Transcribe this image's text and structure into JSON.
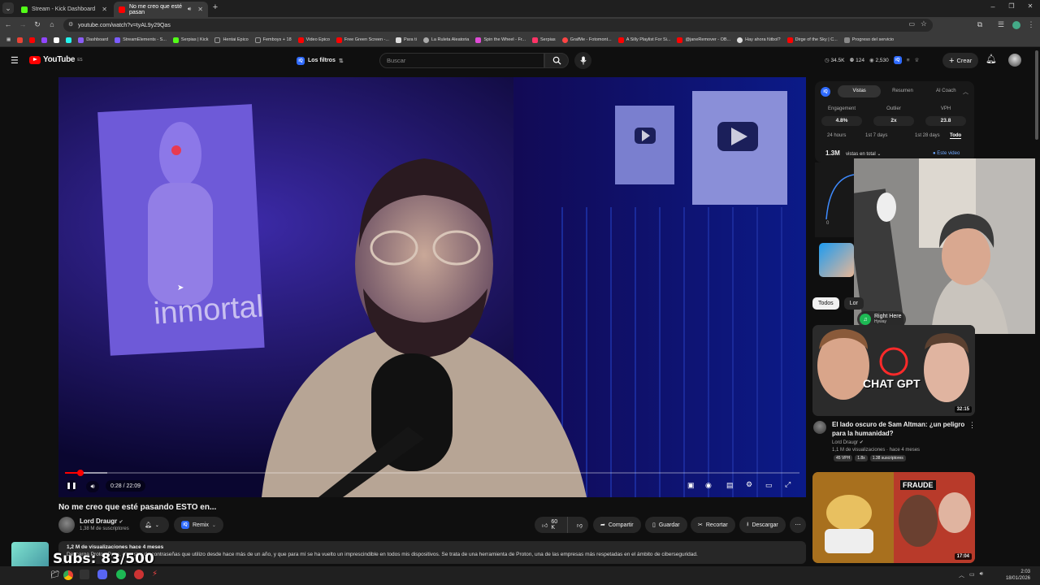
{
  "browser": {
    "tabs": [
      {
        "title": "Stream - Kick Dashboard",
        "favicon_color": "#53fc18"
      },
      {
        "title": "No me creo que esté pasan",
        "favicon_color": "#ff0000"
      }
    ],
    "url": "youtube.com/watch?v=tyAL9y29Qas",
    "bookmarks": [
      {
        "label": "Dashboard",
        "color": "#8a5cf6"
      },
      {
        "label": "StreamElements - S...",
        "color": "#7b5cff"
      },
      {
        "label": "Serpias | Kick",
        "color": "#53fc18"
      },
      {
        "label": "Hentai Epico",
        "color": "#777777"
      },
      {
        "label": "Femboys + 18",
        "color": "#777777"
      },
      {
        "label": "Video Epico",
        "color": "#ff0000"
      },
      {
        "label": "Free Green Screen -...",
        "color": "#ff0000"
      },
      {
        "label": "Para ti",
        "color": "#dddddd"
      },
      {
        "label": "La Ruleta Aleatoria",
        "color": "#aaaaaa"
      },
      {
        "label": "Spin the Wheel - Fr...",
        "color": "#e04bd6"
      },
      {
        "label": "Serpias",
        "color": "#ff3366"
      },
      {
        "label": "GrafMe - Fotomont...",
        "color": "#ff4444"
      },
      {
        "label": "A Silly Playlist For Si...",
        "color": "#ff0000"
      },
      {
        "label": "@janeRemover - OB...",
        "color": "#ff0000"
      },
      {
        "label": "Hay ahora fútbol?",
        "color": "#dddddd"
      },
      {
        "label": "Dirge of the Sky | C...",
        "color": "#ff0000"
      },
      {
        "label": "Progreso del servicio",
        "color": "#888888"
      }
    ]
  },
  "youtube": {
    "logo_text": "YouTube",
    "country_code": "ES",
    "filters_label": "Los filtros",
    "search_placeholder": "Buscar",
    "header_stats": [
      "34.5K",
      "124",
      "2,530"
    ],
    "create_label": "Crear"
  },
  "video": {
    "overlay_text": "inmortal",
    "current_time": "0:28",
    "duration": "22:09",
    "time_display": "0:28 / 22:09",
    "progress_fraction": 0.021,
    "buffer_fraction": 0.058,
    "title": "No me creo que esté pasando ESTO en...",
    "channel": "Lord Draugr",
    "subscribers": "1,38 M de suscriptores",
    "remix_label": "Remix",
    "likes": "60 K",
    "share_label": "Compartir",
    "save_label": "Guardar",
    "clip_label": "Recortar",
    "download_label": "Descargar",
    "desc_meta": "1,2 M de visualizaciones  hace 4 meses",
    "desc_text": "Descarga Proton Pass, el gestor de contraseñas que utilizo desde hace más de un año, y que para mí se ha vuelto un imprescindible en todos mis dispositivos. Se trata de una herramienta de Proton, una de las empresas más respetadas en el ámbito de ciberseguridad."
  },
  "iq_panel": {
    "tabs": [
      "Vistas",
      "Resumen",
      "AI Coach"
    ],
    "metrics": [
      {
        "label": "Engagement",
        "value": "4.8%"
      },
      {
        "label": "Outlier",
        "value": "2x"
      },
      {
        "label": "VPH",
        "value": "23.8"
      }
    ],
    "ranges": [
      "24 hours",
      "1st 7 days",
      "1st 28 days",
      "Todo"
    ],
    "total_views": "1.3M",
    "views_dropdown": "vistas en total",
    "legend_label": "Este video",
    "axis_tick": "0"
  },
  "chips": [
    "Todos",
    "Lor"
  ],
  "recommendations": [
    {
      "title": "El lado oscuro de Sam Altman: ¿un peligro para la humanidad?",
      "channel": "Lord Draugr",
      "meta": "1,1 M de visualizaciones · hace 4 meses",
      "badges": [
        "45 VPH",
        "1.8x",
        "1.38 suscriptores"
      ],
      "duration": "32:15",
      "thumb_text": "CHAT GPT"
    },
    {
      "thumb_text": "FRAUDE",
      "duration": "17:04"
    }
  ],
  "webcam": {
    "song_title": "Right Here",
    "song_artist": "Hyway"
  },
  "stream_overlay": {
    "subs_text": "Subs: 83/500"
  },
  "system": {
    "time": "2:03",
    "date": "18/01/2026"
  }
}
